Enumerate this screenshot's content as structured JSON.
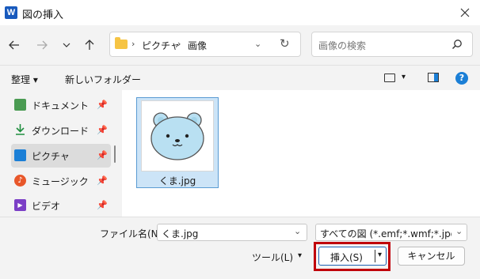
{
  "window": {
    "title": "図の挿入",
    "app_icon_letter": "W"
  },
  "nav": {
    "breadcrumb": [
      "ピクチャ",
      "画像"
    ],
    "search_placeholder": "画像の検索"
  },
  "commands": {
    "organize": "整理 ▾",
    "new_folder": "新しいフォルダー"
  },
  "sidebar": {
    "items": [
      {
        "label": "ドキュメント",
        "icon": "document-icon",
        "color": "#2e7d32"
      },
      {
        "label": "ダウンロード",
        "icon": "download-icon",
        "color": "#1e8e3e"
      },
      {
        "label": "ピクチャ",
        "icon": "pictures-icon",
        "color": "#1b7fd6",
        "selected": true
      },
      {
        "label": "ミュージック",
        "icon": "music-icon",
        "color": "#e8572a"
      },
      {
        "label": "ビデオ",
        "icon": "video-icon",
        "color": "#7b3fc6"
      }
    ]
  },
  "files": [
    {
      "name": "くま.jpg",
      "selected": true
    }
  ],
  "bottom": {
    "filename_label": "ファイル名(N):",
    "filename_value": "くま.jpg",
    "filetype_value": "すべての図 (*.emf;*.wmf;*.jpg;*.j",
    "tools_label": "ツール(L)",
    "insert_label": "挿入(S)",
    "cancel_label": "キャンセル"
  },
  "colors": {
    "accent": "#1b7fd6",
    "highlight_box": "#c0000a",
    "selection": "#cce4f7"
  }
}
